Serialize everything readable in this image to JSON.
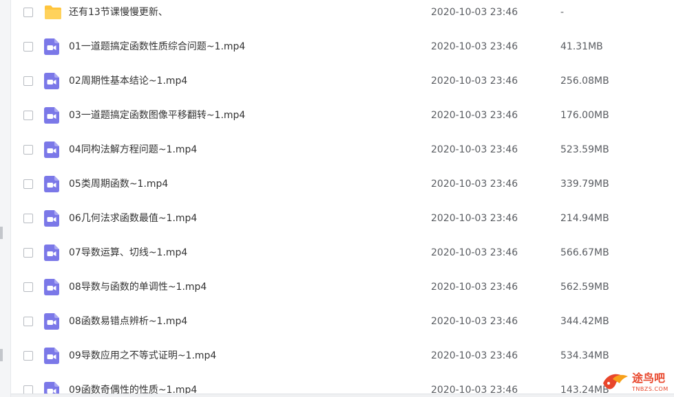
{
  "files": [
    {
      "name": "还有13节课慢慢更新、",
      "date": "2020-10-03 23:46",
      "size": "-",
      "type": "folder"
    },
    {
      "name": "01一道题搞定函数性质综合问题~1.mp4",
      "date": "2020-10-03 23:46",
      "size": "41.31MB",
      "type": "video"
    },
    {
      "name": "02周期性基本结论~1.mp4",
      "date": "2020-10-03 23:46",
      "size": "256.08MB",
      "type": "video"
    },
    {
      "name": "03一道题搞定函数图像平移翻转~1.mp4",
      "date": "2020-10-03 23:46",
      "size": "176.00MB",
      "type": "video"
    },
    {
      "name": "04同构法解方程问题~1.mp4",
      "date": "2020-10-03 23:46",
      "size": "523.59MB",
      "type": "video"
    },
    {
      "name": "05类周期函数~1.mp4",
      "date": "2020-10-03 23:46",
      "size": "339.79MB",
      "type": "video"
    },
    {
      "name": "06几何法求函数最值~1.mp4",
      "date": "2020-10-03 23:46",
      "size": "214.94MB",
      "type": "video"
    },
    {
      "name": "07导数运算、切线~1.mp4",
      "date": "2020-10-03 23:46",
      "size": "566.67MB",
      "type": "video"
    },
    {
      "name": "08导数与函数的单调性~1.mp4",
      "date": "2020-10-03 23:46",
      "size": "562.59MB",
      "type": "video"
    },
    {
      "name": "08函数易错点辨析~1.mp4",
      "date": "2020-10-03 23:46",
      "size": "344.42MB",
      "type": "video"
    },
    {
      "name": "09导数应用之不等式证明~1.mp4",
      "date": "2020-10-03 23:46",
      "size": "534.34MB",
      "type": "video"
    },
    {
      "name": "09函数奇偶性的性质~1.mp4",
      "date": "2020-10-03 23:46",
      "size": "143.24MB",
      "type": "video"
    }
  ],
  "icons": {
    "folder": "folder-icon",
    "video": "video-file-icon"
  },
  "colors": {
    "folder": "#ffc53d",
    "video": "#7b78e8",
    "watermark": "#e8462b"
  },
  "watermark": {
    "name": "途鸟吧",
    "url": "TNBZS.COM"
  }
}
